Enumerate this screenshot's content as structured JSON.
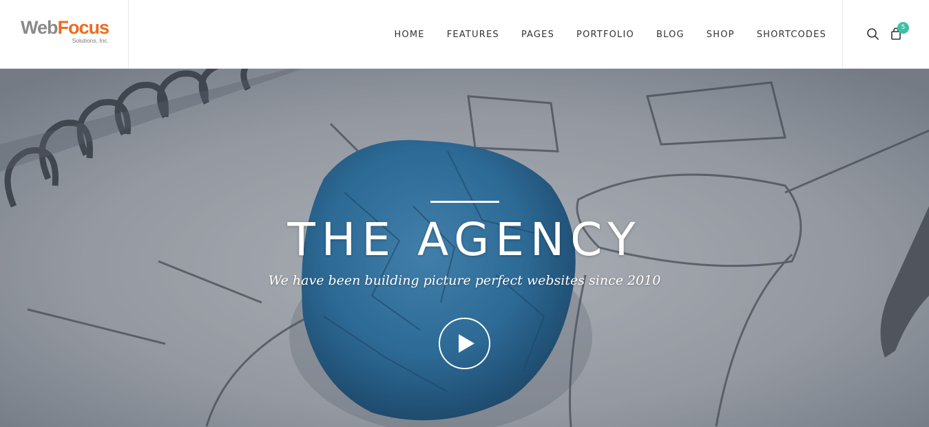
{
  "logo": {
    "brand_part1": "Web",
    "brand_part2": "Focus",
    "tagline": "Solutions, Inc."
  },
  "nav": {
    "items": [
      {
        "label": "HOME"
      },
      {
        "label": "FEATURES"
      },
      {
        "label": "PAGES"
      },
      {
        "label": "PORTFOLIO"
      },
      {
        "label": "BLOG"
      },
      {
        "label": "SHOP"
      },
      {
        "label": "SHORTCODES"
      }
    ]
  },
  "tools": {
    "search_icon": "search-icon",
    "cart_icon": "shopping-bag-icon",
    "cart_count": "5"
  },
  "hero": {
    "title": "THE AGENCY",
    "subtitle": "We have been building picture perfect websites since 2010",
    "play_icon": "play-icon"
  },
  "colors": {
    "accent": "#3cc1a6",
    "logo_gray": "#8a8a8a",
    "logo_orange": "#ef6a1c",
    "paper_blue": "#2f7fb5"
  }
}
